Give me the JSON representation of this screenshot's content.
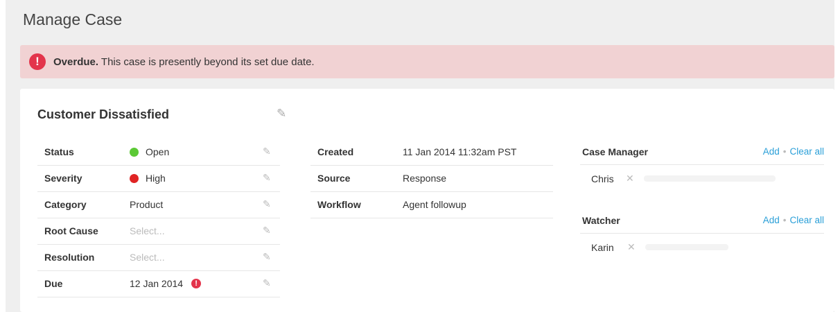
{
  "page": {
    "title": "Manage Case"
  },
  "alert": {
    "strong": "Overdue.",
    "message": " This case is presently beyond its set due date.",
    "icon": "exclamation-icon"
  },
  "case": {
    "title": "Customer Dissatisfied"
  },
  "details": [
    {
      "label": "Status",
      "value": "Open",
      "dot_color": "#5cc935"
    },
    {
      "label": "Severity",
      "value": "High",
      "dot_color": "#e02424"
    },
    {
      "label": "Category",
      "value": "Product"
    },
    {
      "label": "Root Cause",
      "placeholder": "Select..."
    },
    {
      "label": "Resolution",
      "placeholder": "Select..."
    },
    {
      "label": "Due",
      "value": "12 Jan 2014",
      "warning": true
    }
  ],
  "meta": [
    {
      "label": "Created",
      "value": "11 Jan 2014 11:32am PST"
    },
    {
      "label": "Source",
      "value": "Response",
      "link": true
    },
    {
      "label": "Workflow",
      "value": "Agent followup",
      "link": true
    }
  ],
  "case_manager": {
    "label": "Case Manager",
    "add": "Add",
    "clear": "Clear all",
    "people": [
      "Chris"
    ]
  },
  "watcher": {
    "label": "Watcher",
    "add": "Add",
    "clear": "Clear all",
    "people": [
      "Karin"
    ]
  },
  "colors": {
    "accent_link": "#2a9fd8",
    "alert_bg": "#f1d2d3",
    "alert_icon": "#e3344b"
  }
}
